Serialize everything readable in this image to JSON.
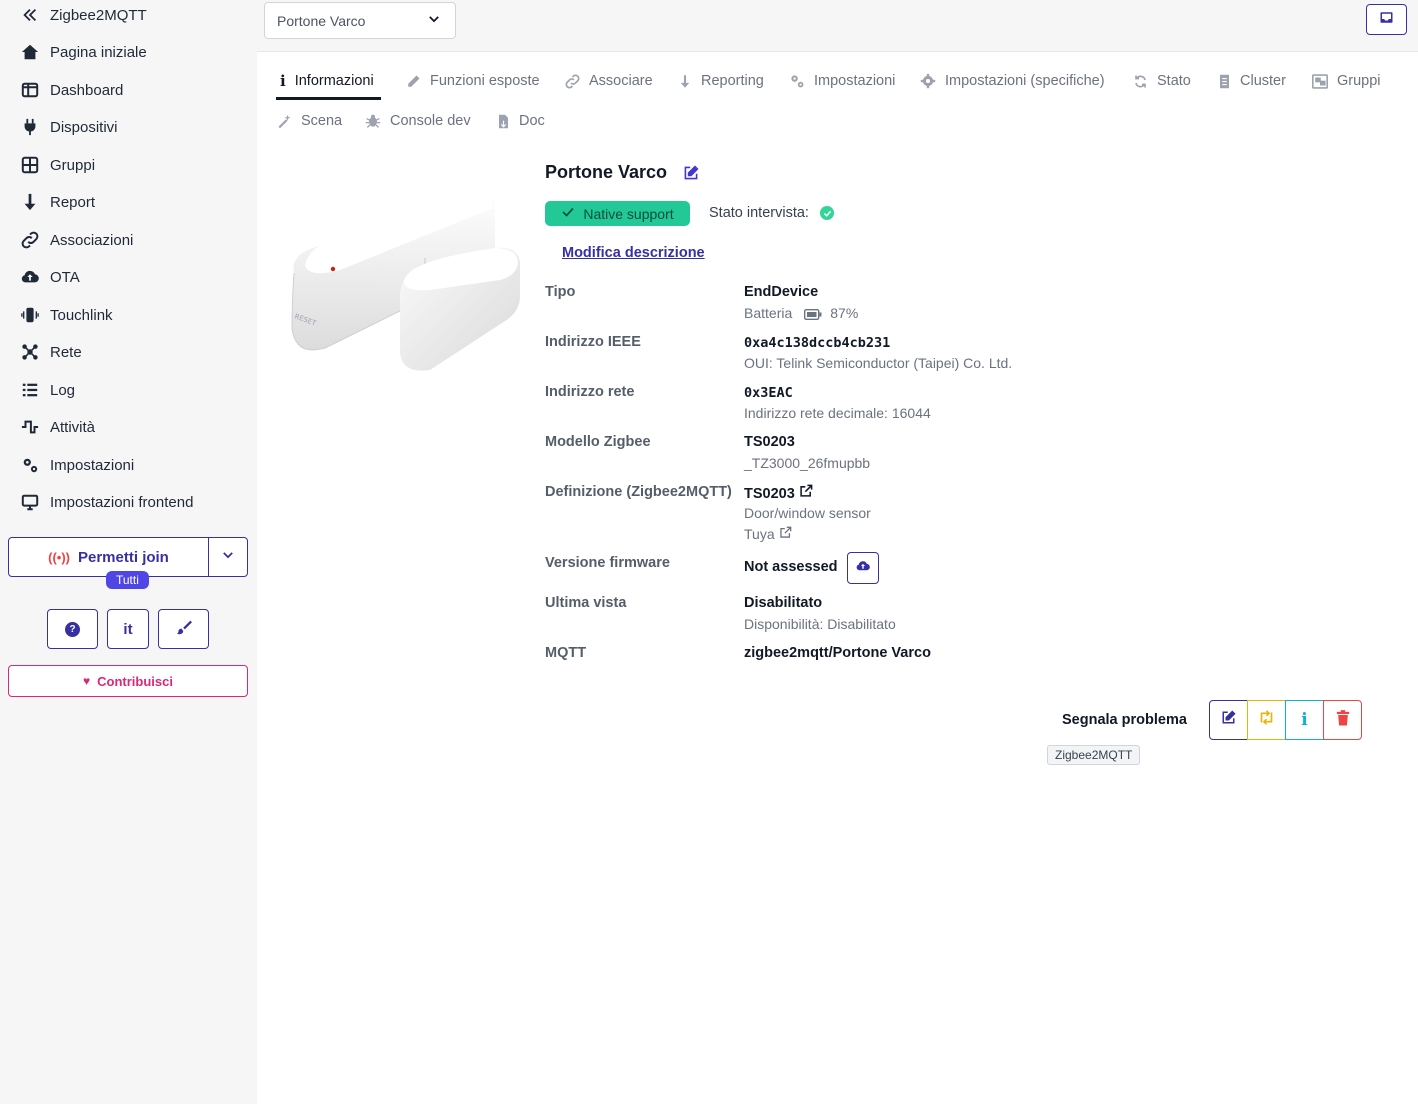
{
  "sidebar": {
    "brand": "Zigbee2MQTT",
    "items": [
      {
        "label": "Pagina iniziale",
        "icon": "home-icon"
      },
      {
        "label": "Dashboard",
        "icon": "dashboard-icon"
      },
      {
        "label": "Dispositivi",
        "icon": "plug-icon"
      },
      {
        "label": "Gruppi",
        "icon": "grid-icon"
      },
      {
        "label": "Report",
        "icon": "arrow-down-icon"
      },
      {
        "label": "Associazioni",
        "icon": "link-icon"
      },
      {
        "label": "OTA",
        "icon": "cloud-upload-icon"
      },
      {
        "label": "Touchlink",
        "icon": "touchlink-icon"
      },
      {
        "label": "Rete",
        "icon": "network-icon"
      },
      {
        "label": "Log",
        "icon": "list-icon"
      },
      {
        "label": "Attività",
        "icon": "activity-icon"
      },
      {
        "label": "Impostazioni",
        "icon": "gears-icon"
      },
      {
        "label": "Impostazioni frontend",
        "icon": "monitor-icon"
      }
    ],
    "permit_join_label": "Permetti join",
    "permit_join_target": "Tutti",
    "help_label": "?",
    "language_label": "it",
    "contribute_label": "Contribuisci"
  },
  "header": {
    "device_select_value": "Portone Varco"
  },
  "tabs": [
    {
      "label": "Informazioni",
      "icon": "info-icon",
      "active": true
    },
    {
      "label": "Funzioni esposte",
      "icon": "pencil-icon"
    },
    {
      "label": "Associare",
      "icon": "link-icon"
    },
    {
      "label": "Reporting",
      "icon": "arrow-down-icon"
    },
    {
      "label": "Impostazioni",
      "icon": "gears-icon"
    },
    {
      "label": "Impostazioni (specifiche)",
      "icon": "gear-icon"
    },
    {
      "label": "Stato",
      "icon": "refresh-icon"
    },
    {
      "label": "Cluster",
      "icon": "document-icon"
    },
    {
      "label": "Gruppi",
      "icon": "group-icon"
    },
    {
      "label": "Scena",
      "icon": "magic-wand-icon"
    },
    {
      "label": "Console dev",
      "icon": "bug-icon"
    },
    {
      "label": "Doc",
      "icon": "file-icon"
    }
  ],
  "device": {
    "name": "Portone Varco",
    "support_badge": "Native support",
    "interview_label": "Stato intervista:",
    "modify_description": "Modifica descrizione",
    "rows": {
      "type": {
        "label": "Tipo",
        "value": "EndDevice",
        "sub_label": "Batteria",
        "battery": "87%"
      },
      "ieee": {
        "label": "Indirizzo IEEE",
        "value": "0xa4c138dccb4cb231",
        "sub": "OUI: Telink Semiconductor (Taipei) Co. Ltd."
      },
      "network": {
        "label": "Indirizzo rete",
        "value": "0x3EAC",
        "sub": "Indirizzo rete decimale: 16044"
      },
      "model": {
        "label": "Modello Zigbee",
        "value": "TS0203",
        "sub": "_TZ3000_26fmupbb"
      },
      "definition": {
        "label": "Definizione (Zigbee2MQTT)",
        "value": "TS0203",
        "sub": "Door/window sensor",
        "vendor": "Tuya"
      },
      "firmware": {
        "label": "Versione firmware",
        "value": "Not assessed"
      },
      "last_seen": {
        "label": "Ultima vista",
        "value": "Disabilitato",
        "sub": "Disponibilità: Disabilitato"
      },
      "mqtt": {
        "label": "MQTT",
        "value": "zigbee2mqtt/Portone Varco"
      }
    }
  },
  "actions": {
    "report_label": "Segnala problema",
    "tooltip": "Zigbee2MQTT"
  },
  "colors": {
    "accent": "#3730a3",
    "success": "#22c997",
    "warning": "#eab308",
    "info": "#06b6d4",
    "danger": "#ef4444",
    "pink": "#db2777"
  }
}
